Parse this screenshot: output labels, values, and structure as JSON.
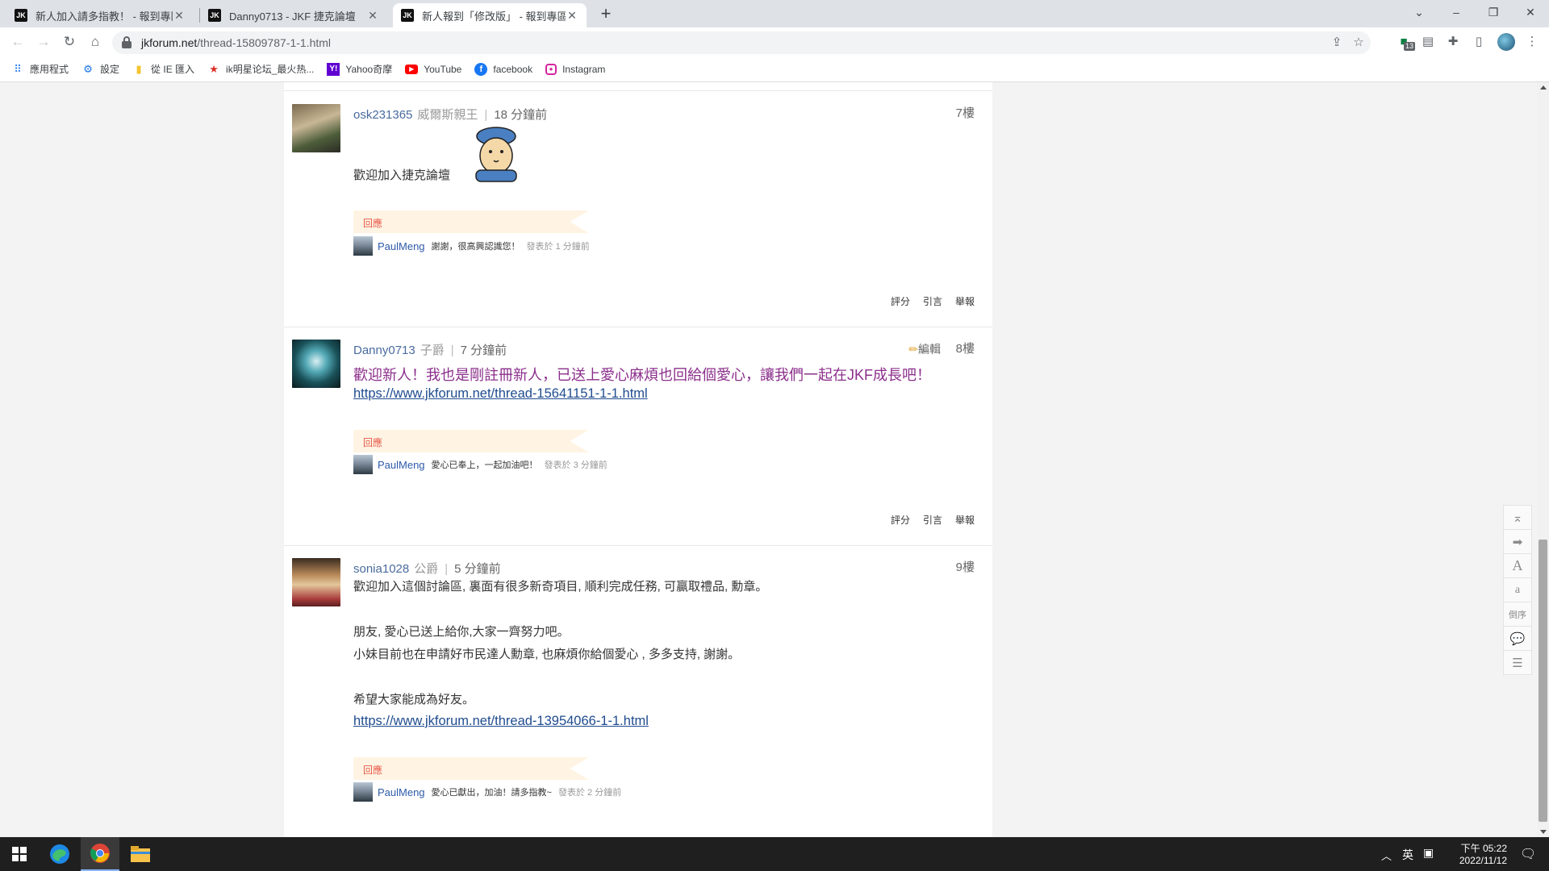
{
  "browser": {
    "tabs": [
      {
        "favicon": "JK",
        "title": "新人加入請多指教！ - 報到專區 ·",
        "active": false
      },
      {
        "favicon": "JK",
        "title": "Danny0713 - JKF 捷克論壇",
        "active": false
      },
      {
        "favicon": "JK",
        "title": "新人報到「修改版」 - 報到專區 ·",
        "active": true
      }
    ],
    "new_tab": "+",
    "window_controls": {
      "dropdown": "⌄",
      "minimize": "–",
      "restore": "❐",
      "close": "✕"
    },
    "url_host": "jkforum.net",
    "url_path": "/thread-15809787-1-1.html",
    "extension_badge": "13",
    "bookmarks": [
      {
        "icon": "apps-icon",
        "label": "應用程式"
      },
      {
        "icon": "gear-icon",
        "label": "設定"
      },
      {
        "icon": "folder-icon",
        "label": "從 IE 匯入"
      },
      {
        "icon": "star-icon",
        "label": "ik明星论坛_最火热..."
      },
      {
        "icon": "yahoo-icon",
        "label": "Yahoo奇摩"
      },
      {
        "icon": "youtube-icon",
        "label": "YouTube"
      },
      {
        "icon": "facebook-icon",
        "label": "facebook"
      },
      {
        "icon": "instagram-icon",
        "label": "Instagram"
      }
    ]
  },
  "posts": [
    {
      "author": "osk231365",
      "rank": "威爾斯親王",
      "time": "18 分鐘前",
      "floor": "7樓",
      "body_lines": [
        "歡迎加入捷克論壇"
      ],
      "reply_label": "回應",
      "reply": {
        "name": "PaulMeng",
        "message": "謝謝，很高興認識您！",
        "time": "發表於 1 分鐘前"
      },
      "actions": [
        "評分",
        "引言",
        "舉報"
      ]
    },
    {
      "author": "Danny0713",
      "rank": "子爵",
      "time": "7 分鐘前",
      "floor": "8樓",
      "edit_label": "編輯",
      "highlight": "歡迎新人！我也是剛註冊新人，已送上愛心麻煩也回給個愛心，讓我們一起在JKF成長吧！",
      "link": "https://www.jkforum.net/thread-15641151-1-1.html",
      "reply_label": "回應",
      "reply": {
        "name": "PaulMeng",
        "message": "愛心已奉上，一起加油吧！",
        "time": "發表於 3 分鐘前"
      },
      "actions": [
        "評分",
        "引言",
        "舉報"
      ]
    },
    {
      "author": "sonia1028",
      "rank": "公爵",
      "time": "5 分鐘前",
      "floor": "9樓",
      "body_lines": [
        "歡迎加入這個討論區, 裏面有很多新奇項目, 順利完成任務, 可贏取禮品, 勳章。",
        "朋友, 愛心已送上給你,大家一齊努力吧。",
        "小妹目前也在申請好市民達人勳章, 也麻煩你給個愛心 , 多多支持, 謝謝。",
        "希望大家能成為好友。"
      ],
      "link": "https://www.jkforum.net/thread-13954066-1-1.html",
      "reply_label": "回應",
      "reply": {
        "name": "PaulMeng",
        "message": "愛心已獻出，加油！請多指教~",
        "time": "發表於 2 分鐘前"
      }
    }
  ],
  "side_tools": [
    {
      "icon": "scroll-top-icon",
      "label": "⌅"
    },
    {
      "icon": "next-arrow-icon",
      "label": "➡"
    },
    {
      "icon": "font-larger-icon",
      "label": "A"
    },
    {
      "icon": "font-smaller-icon",
      "label": "a"
    },
    {
      "icon": "reverse-order-icon",
      "label": "倒序"
    },
    {
      "icon": "comment-icon",
      "label": "💬"
    },
    {
      "icon": "list-icon",
      "label": "☰"
    }
  ],
  "taskbar": {
    "ime": "英",
    "time": "下午 05:22",
    "date": "2022/11/12"
  }
}
